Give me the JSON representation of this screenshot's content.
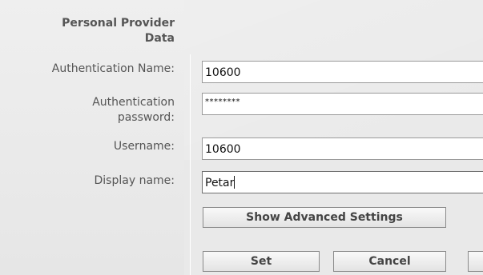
{
  "section": {
    "title_line1": "Personal Provider",
    "title_line2": "Data"
  },
  "fields": {
    "auth_name": {
      "label": "Authentication Name:",
      "value": "10600"
    },
    "auth_password": {
      "label_line1": "Authentication",
      "label_line2": "password:",
      "value": "********"
    },
    "username": {
      "label": "Username:",
      "value": "10600"
    },
    "display_name": {
      "label": "Display name:",
      "value": "Petar"
    }
  },
  "buttons": {
    "advanced": "Show Advanced Settings",
    "set": "Set",
    "cancel": "Cancel"
  }
}
